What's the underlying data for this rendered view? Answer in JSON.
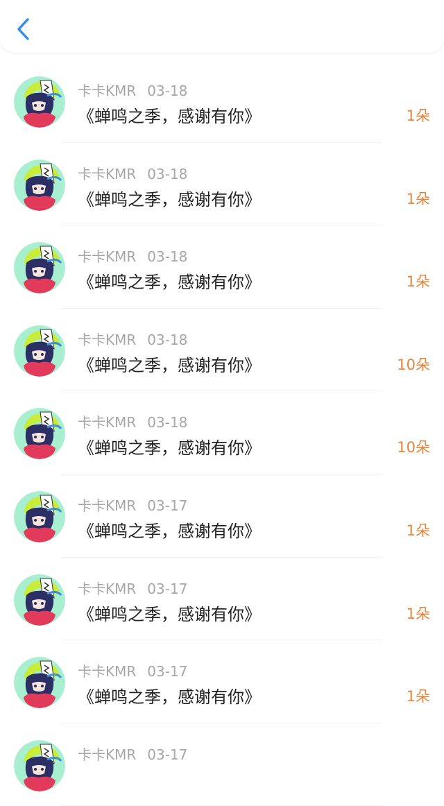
{
  "header": {
    "back_icon": "chevron-left-icon",
    "accent_color": "#2f8cf0"
  },
  "colors": {
    "count": "#e8843a",
    "meta": "#a6a6a6"
  },
  "items": [
    {
      "user": "卡卡KMR",
      "date": "03-18",
      "message": "《蝉鸣之季，感谢有你》",
      "count": "1朵"
    },
    {
      "user": "卡卡KMR",
      "date": "03-18",
      "message": "《蝉鸣之季，感谢有你》",
      "count": "1朵"
    },
    {
      "user": "卡卡KMR",
      "date": "03-18",
      "message": "《蝉鸣之季，感谢有你》",
      "count": "1朵"
    },
    {
      "user": "卡卡KMR",
      "date": "03-18",
      "message": "《蝉鸣之季，感谢有你》",
      "count": "10朵"
    },
    {
      "user": "卡卡KMR",
      "date": "03-18",
      "message": "《蝉鸣之季，感谢有你》",
      "count": "10朵"
    },
    {
      "user": "卡卡KMR",
      "date": "03-17",
      "message": "《蝉鸣之季，感谢有你》",
      "count": "1朵"
    },
    {
      "user": "卡卡KMR",
      "date": "03-17",
      "message": "《蝉鸣之季，感谢有你》",
      "count": "1朵"
    },
    {
      "user": "卡卡KMR",
      "date": "03-17",
      "message": "《蝉鸣之季，感谢有你》",
      "count": "1朵"
    },
    {
      "user": "卡卡KMR",
      "date": "03-17",
      "message": "",
      "count": ""
    }
  ]
}
